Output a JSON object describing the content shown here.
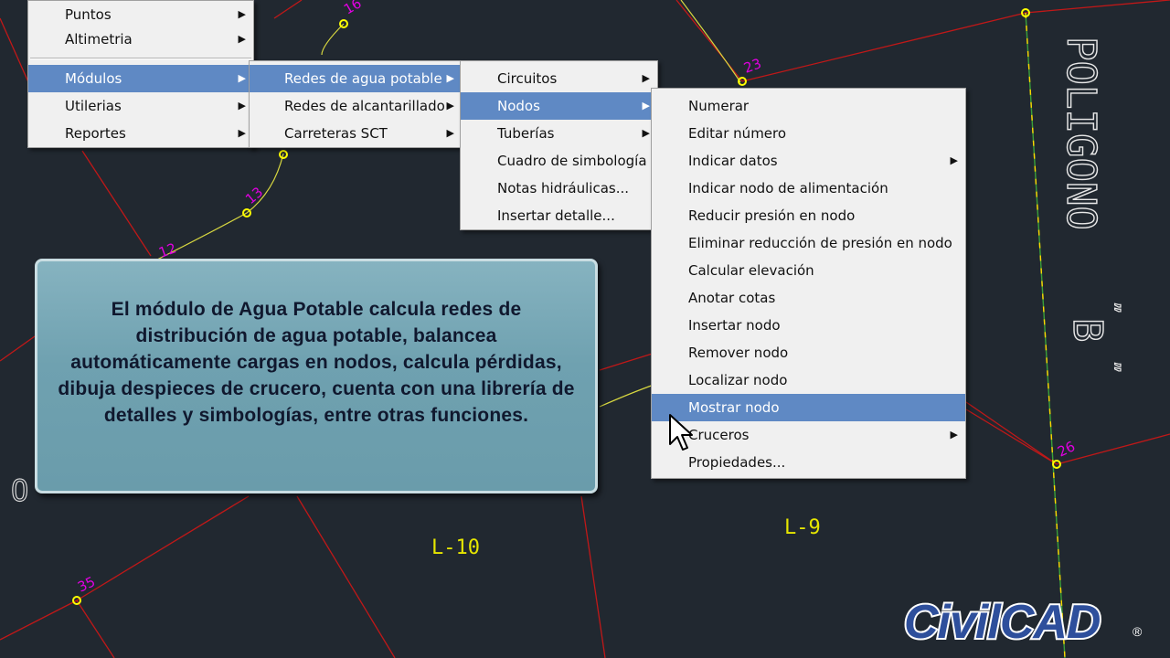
{
  "menus": {
    "main": [
      {
        "label": "Puntos",
        "has_submenu": true
      },
      {
        "label": "Altimetria",
        "has_submenu": true
      },
      {
        "label": "Módulos",
        "has_submenu": true,
        "selected": true
      },
      {
        "label": "Utilerias",
        "has_submenu": true
      },
      {
        "label": "Reportes",
        "has_submenu": true
      }
    ],
    "modulos": [
      {
        "label": "Redes de agua potable",
        "has_submenu": true,
        "selected": true
      },
      {
        "label": "Redes de alcantarillado",
        "has_submenu": true
      },
      {
        "label": "Carreteras SCT",
        "has_submenu": true
      }
    ],
    "agua_potable": [
      {
        "label": "Circuitos",
        "has_submenu": true
      },
      {
        "label": "Nodos",
        "has_submenu": true,
        "selected": true
      },
      {
        "label": "Tuberías",
        "has_submenu": true
      },
      {
        "label": "Cuadro de simbología",
        "has_submenu": false
      },
      {
        "label": "Notas hidráulicas...",
        "has_submenu": false
      },
      {
        "label": "Insertar detalle...",
        "has_submenu": false
      }
    ],
    "nodos": [
      {
        "label": "Numerar",
        "has_submenu": false
      },
      {
        "label": "Editar número",
        "has_submenu": false
      },
      {
        "label": "Indicar datos",
        "has_submenu": true
      },
      {
        "label": "Indicar nodo de alimentación",
        "has_submenu": false
      },
      {
        "label": "Reducir presión en nodo",
        "has_submenu": false
      },
      {
        "label": "Eliminar reducción de presión en nodo",
        "has_submenu": false
      },
      {
        "label": "Calcular elevación",
        "has_submenu": false
      },
      {
        "label": "Anotar cotas",
        "has_submenu": false
      },
      {
        "label": "Insertar nodo",
        "has_submenu": false
      },
      {
        "label": "Remover nodo",
        "has_submenu": false
      },
      {
        "label": "Localizar nodo",
        "has_submenu": false
      },
      {
        "label": "Mostrar nodo",
        "has_submenu": false,
        "selected": true
      },
      {
        "label": "Cruceros",
        "has_submenu": true
      },
      {
        "label": "Propiedades...",
        "has_submenu": false
      }
    ]
  },
  "infobox": {
    "text": "El módulo de Agua Potable calcula redes de distribución de agua potable, balancea automáticamente cargas en nodos, calcula pérdidas, dibuja despieces de crucero, cuenta con una librería de detalles y simbologías, entre otras funciones."
  },
  "drawing": {
    "node_labels": [
      "16",
      "23",
      "13",
      "12",
      "26",
      "35"
    ],
    "lot_labels": [
      "L-10",
      "L-9"
    ],
    "polygon_label": "POLIGONO",
    "polygon_letter": "B",
    "colors": {
      "background": "#212830",
      "red_line": "#c01818",
      "node": "#ffff00",
      "label": "#e000e0",
      "lot_text": "#e6e600",
      "menu_highlight": "#5f89c4"
    }
  },
  "logo": {
    "text": "CivilCAD",
    "mark": "®"
  }
}
